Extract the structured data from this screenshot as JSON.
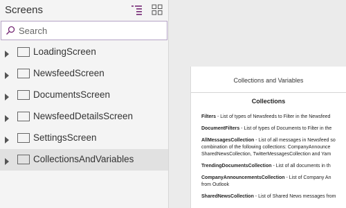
{
  "pane": {
    "title": "Screens",
    "search_placeholder": "Search",
    "search_value": ""
  },
  "screens": [
    {
      "label": "LoadingScreen",
      "icon": "screen-icon",
      "selected": false
    },
    {
      "label": "NewsfeedScreen",
      "icon": "screen-icon",
      "selected": false
    },
    {
      "label": "DocumentsScreen",
      "icon": "screen-icon",
      "selected": false
    },
    {
      "label": "NewsfeedDetailsScreen",
      "icon": "screen-icon",
      "selected": false
    },
    {
      "label": "SettingsScreen",
      "icon": "screen-icon",
      "selected": false
    },
    {
      "label": "CollectionsAndVariables",
      "icon": "screen-icon",
      "selected": true
    }
  ],
  "preview": {
    "header_title": "Collections and Variables",
    "heading": "Collections",
    "items": [
      {
        "name": "Filters",
        "lines": [
          "Filters - List of types of Newsfeeds to Filter in the Newsfeed"
        ]
      },
      {
        "name": "DocumentFilters",
        "lines": [
          "DocumentFilters - List of types of Documents to Filter in the"
        ]
      },
      {
        "name": "AllMessagesCollection",
        "lines": [
          "AllMessagesCollection - List of all messages in Newsfeed so",
          "combination of the following collections: CompanyAnnounce",
          "SharedNewsCollection, TwitterMessagesCollection and Yam"
        ]
      },
      {
        "name": "TrendingDocumentsCollection",
        "lines": [
          "TrendingDocumentsCollection - List of all documents in th"
        ]
      },
      {
        "name": "CompanyAnnouncementsCollection",
        "lines": [
          "CompanyAnnouncementsCollection - List of Company An",
          "from Outlook"
        ]
      },
      {
        "name": "SharedNewsCollection",
        "lines": [
          "SharedNewsCollection - List of Shared News messages from"
        ]
      }
    ]
  },
  "colors": {
    "accent": "#742774",
    "pane_bg": "#f4f4f4",
    "selected_row": "#e1e1e1",
    "canvas_bg": "#ebebeb"
  }
}
